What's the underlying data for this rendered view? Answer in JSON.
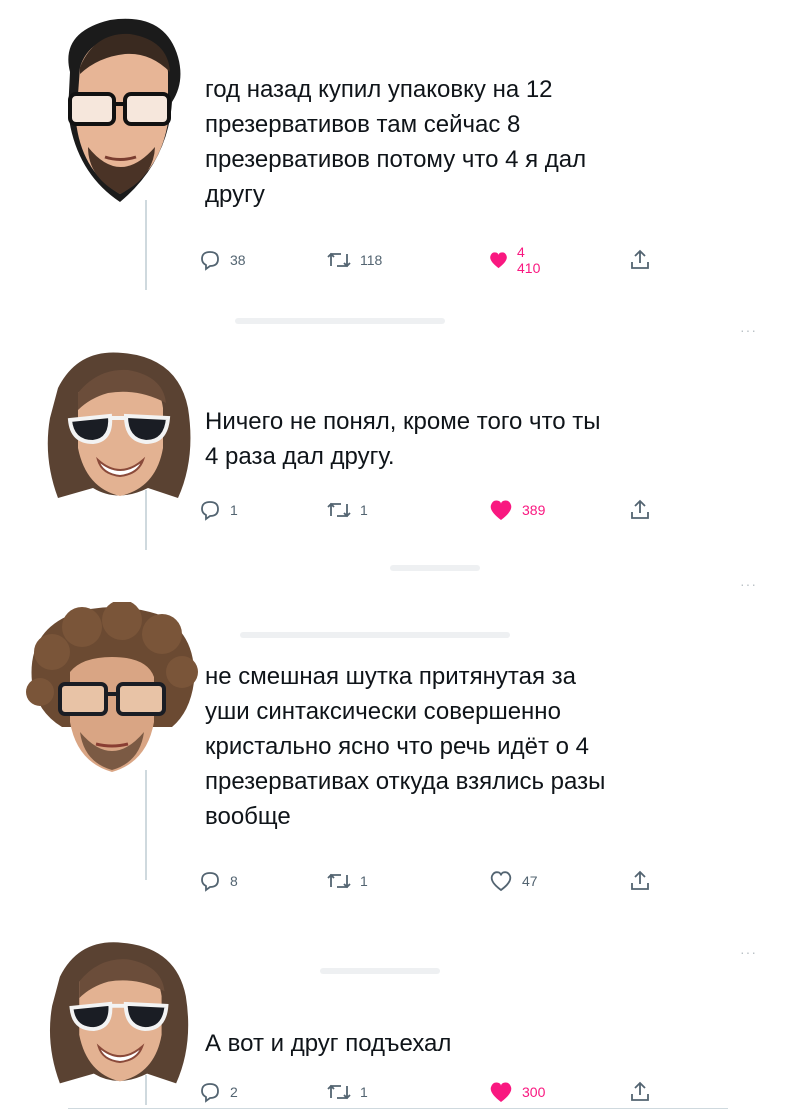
{
  "tweets": [
    {
      "avatar": "avatar-glasses-beard",
      "text": "год назад купил упаковку на 12\nпрезервативов там сейчас 8\nпрезервативов потому что 4 я дал\nдругу",
      "replies": "38",
      "retweets": "118",
      "likes": "4 410",
      "liked": true
    },
    {
      "avatar": "avatar-sunglasses-longhair",
      "text": "Ничего не понял, кроме того что ты\n4 раза дал другу.",
      "replies": "1",
      "retweets": "1",
      "likes": "389",
      "liked": true
    },
    {
      "avatar": "avatar-curly-glasses",
      "text": "не смешная шутка притянутая за\nуши синтаксически совершенно\nкристально ясно что речь идёт о 4\nпрезервативах откуда взялись разы\nвообще",
      "replies": "8",
      "retweets": "1",
      "likes": "47",
      "liked": false
    },
    {
      "avatar": "avatar-sunglasses-longhair",
      "text": "А вот и друг подъехал",
      "replies": "2",
      "retweets": "1",
      "likes": "300",
      "liked": true
    }
  ],
  "icons": {
    "reply": "reply-icon",
    "retweet": "retweet-icon",
    "like": "heart-icon",
    "share": "share-icon",
    "more": "more-icon"
  },
  "more_label": "···",
  "colors": {
    "like_active": "#f91880",
    "muted": "#536471",
    "thread_line": "#cfd9de"
  }
}
